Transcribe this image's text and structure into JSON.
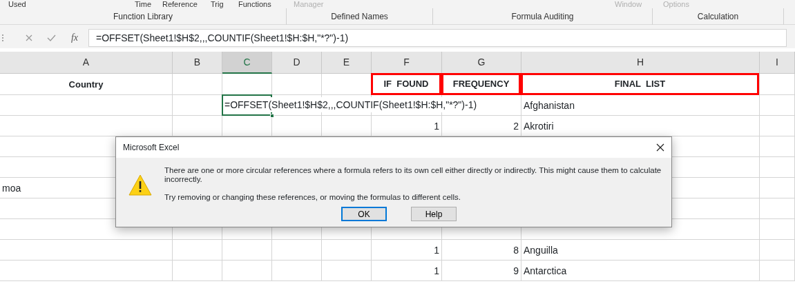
{
  "ribbon": {
    "items": [
      {
        "label": "Used",
        "disabled": false
      },
      {
        "label": "Time",
        "disabled": false
      },
      {
        "label": "Reference",
        "disabled": false
      },
      {
        "label": "Trig",
        "disabled": false
      },
      {
        "label": "Functions",
        "disabled": false
      },
      {
        "label": "Manager",
        "disabled": true
      },
      {
        "label": "Window",
        "disabled": true
      },
      {
        "label": "Options",
        "disabled": true
      }
    ],
    "groups": [
      "Function Library",
      "Defined Names",
      "Formula Auditing",
      "Calculation"
    ]
  },
  "formula_bar": {
    "function_symbol": "fx",
    "value": "=OFFSET(Sheet1!$H$2,,,COUNTIF(Sheet1!$H:$H,\"*?\")-1)"
  },
  "sheet": {
    "columns": [
      {
        "label": "A",
        "selected": false
      },
      {
        "label": "B",
        "selected": false
      },
      {
        "label": "C",
        "selected": true
      },
      {
        "label": "D",
        "selected": false
      },
      {
        "label": "E",
        "selected": false
      },
      {
        "label": "F",
        "selected": false
      },
      {
        "label": "G",
        "selected": false
      },
      {
        "label": "H",
        "selected": false
      },
      {
        "label": "I",
        "selected": false
      }
    ],
    "rows": [
      {
        "cells": [
          {
            "kind": "heading",
            "text": "Country",
            "selected": false
          },
          "",
          "",
          "",
          "",
          {
            "kind": "boxed-heading",
            "text": "IF  FOUND",
            "selected": false
          },
          {
            "kind": "boxed-heading",
            "text": "FREQUENCY",
            "selected": false
          },
          {
            "kind": "boxed-heading",
            "text": "FINAL  LIST",
            "selected": false
          }
        ]
      },
      {
        "cells": [
          "",
          "",
          {
            "kind": "text",
            "text": "=OFFSET(Sheet1!$H$2,,,COUNTIF(Sheet1!$H:$H,\"*?\")-1)",
            "selected": true
          },
          "",
          "",
          "",
          "",
          {
            "kind": "text",
            "text": "Afghanistan",
            "selected": false
          }
        ]
      },
      {
        "cells": [
          "",
          "",
          "",
          "",
          "",
          {
            "kind": "number",
            "text": "1",
            "selected": false
          },
          {
            "kind": "number",
            "text": "2",
            "selected": false
          },
          {
            "kind": "text",
            "text": "Akrotiri",
            "selected": false
          }
        ]
      },
      {
        "cells": []
      },
      {
        "cells": []
      },
      {
        "cells": [
          {
            "kind": "text",
            "text": "moa",
            "selected": false
          }
        ]
      },
      {
        "cells": []
      },
      {
        "cells": []
      },
      {
        "cells": [
          "",
          "",
          "",
          "",
          "",
          {
            "kind": "number",
            "text": "1",
            "selected": false
          },
          {
            "kind": "number",
            "text": "8",
            "selected": false
          },
          {
            "kind": "text",
            "text": "Anguilla",
            "selected": false
          }
        ]
      },
      {
        "cells": [
          "",
          "",
          "",
          "",
          "",
          {
            "kind": "number",
            "text": "1",
            "selected": false
          },
          {
            "kind": "number",
            "text": "9",
            "selected": false
          },
          {
            "kind": "text",
            "text": "Antarctica",
            "selected": false
          }
        ]
      }
    ]
  },
  "dialog": {
    "title": "Microsoft Excel",
    "messages": [
      "There are one or more circular references where a formula refers to its own cell either directly or indirectly. This might cause them to calculate incorrectly.",
      "Try removing or changing these references, or moving the formulas to different cells."
    ],
    "buttons": [
      {
        "label": "OK",
        "default": true
      },
      {
        "label": "Help",
        "default": false
      }
    ]
  }
}
